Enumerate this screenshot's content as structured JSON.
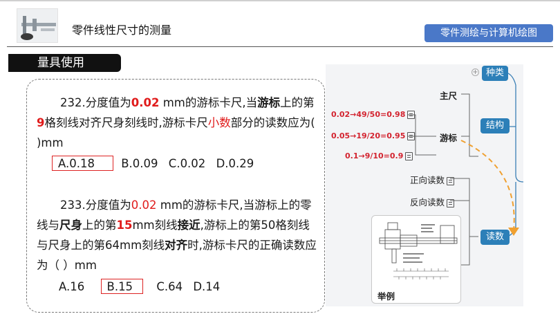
{
  "header": {
    "title": "零件线性尺寸的测量",
    "course": "零件测绘与计算机绘图"
  },
  "section_tag": "量具使用",
  "q232": {
    "parts": [
      "232.分度值为",
      "0.02",
      " mm的游标卡尺,当",
      "游标",
      "上的第",
      "9",
      "格刻线对齐尺身刻线时,游标卡尺",
      "小数",
      "部分的读数应为(   )mm"
    ],
    "options": [
      "A.0.18",
      "B.0.09",
      "C.0.02",
      "D.0.29"
    ]
  },
  "q233": {
    "parts": [
      "233.分度值为",
      "0.02",
      " mm的游标卡尺,当游标上的零线与",
      "尺身",
      "上的第",
      "15",
      "mm刻线",
      "接近",
      ",游标上的第50格刻线与尺身上的第64mm刻线",
      "对齐",
      "时,游标卡尺的正确读数应为（   ）mm"
    ],
    "options": [
      "A.16",
      "B.15",
      "C.64",
      "D.14"
    ]
  },
  "mindmap": {
    "types": "种类",
    "structure": "结构",
    "reading": "读数",
    "main_scale": "主尺",
    "vernier": "游标",
    "r1": "0.02→49/50=0.98",
    "r2": "0.05→19/20=0.95",
    "r3": "0.1→9/10=0.9",
    "forward": "正向读数",
    "reverse": "反向读数",
    "example": "举例"
  },
  "colors": {
    "accent_blue": "#4a78c8",
    "node_blue": "#2c7fb8",
    "highlight_red": "#e01b1b",
    "arrow_orange": "#f0a030"
  }
}
